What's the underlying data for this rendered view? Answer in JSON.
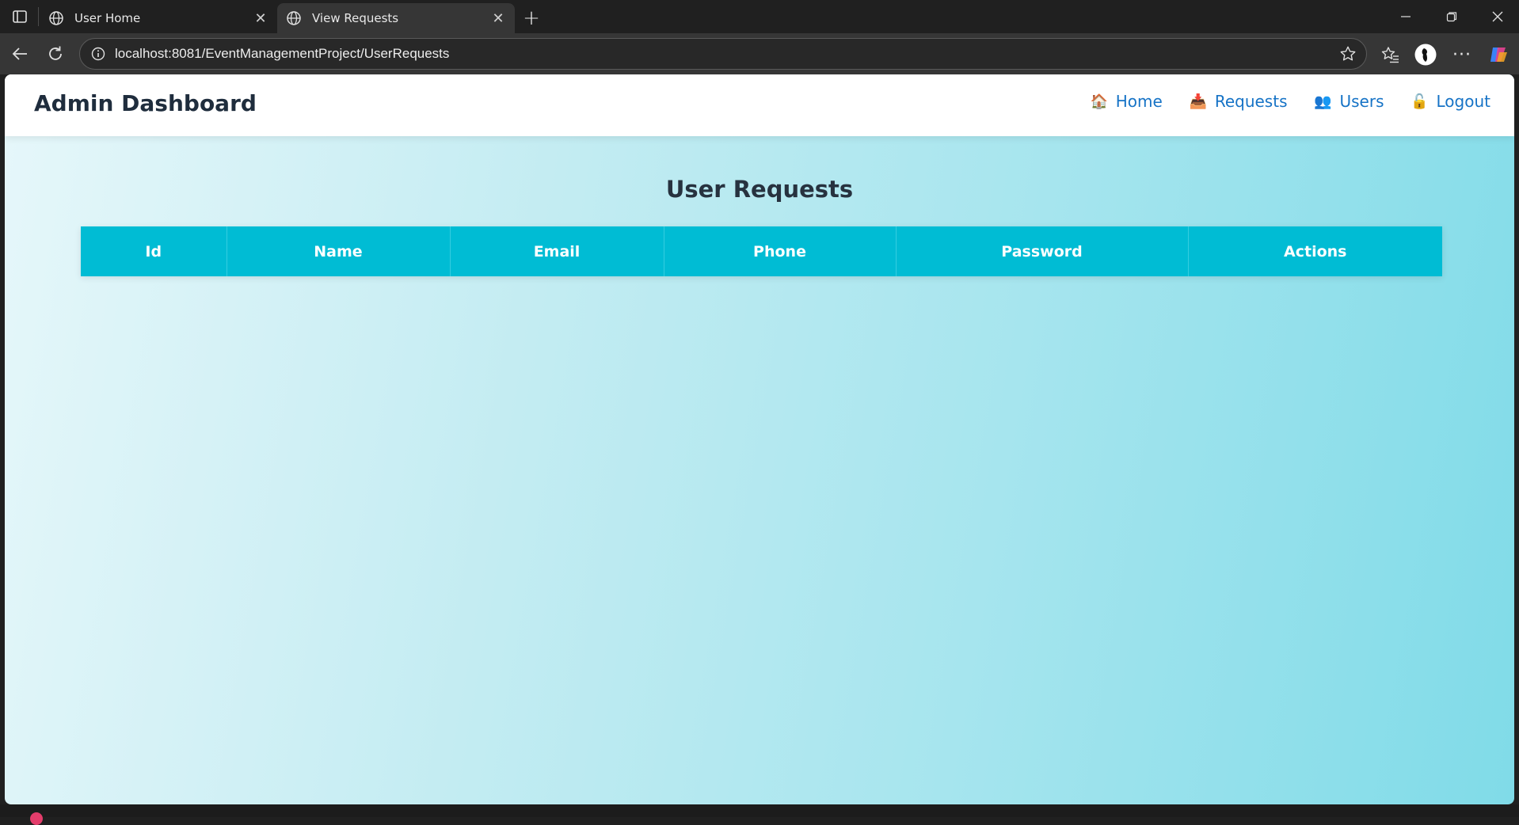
{
  "browser": {
    "tabs": [
      {
        "title": "User Home",
        "active": false
      },
      {
        "title": "View Requests",
        "active": true
      }
    ],
    "new_tab_label": "+",
    "url": "localhost:8081/EventManagementProject/UserRequests",
    "more_label": "···"
  },
  "navbar": {
    "brand": "Admin Dashboard",
    "links": [
      {
        "icon": "🏠",
        "label": "Home"
      },
      {
        "icon": "📥",
        "label": "Requests"
      },
      {
        "icon": "👥",
        "label": "Users"
      },
      {
        "icon": "🔓",
        "label": "Logout"
      }
    ]
  },
  "page": {
    "heading": "User Requests",
    "table": {
      "columns": [
        "Id",
        "Name",
        "Email",
        "Phone",
        "Password",
        "Actions"
      ],
      "rows": []
    }
  },
  "colors": {
    "header_bg": "#00bcd4",
    "link": "#1673c6",
    "brand_text": "#1f2d3d"
  }
}
